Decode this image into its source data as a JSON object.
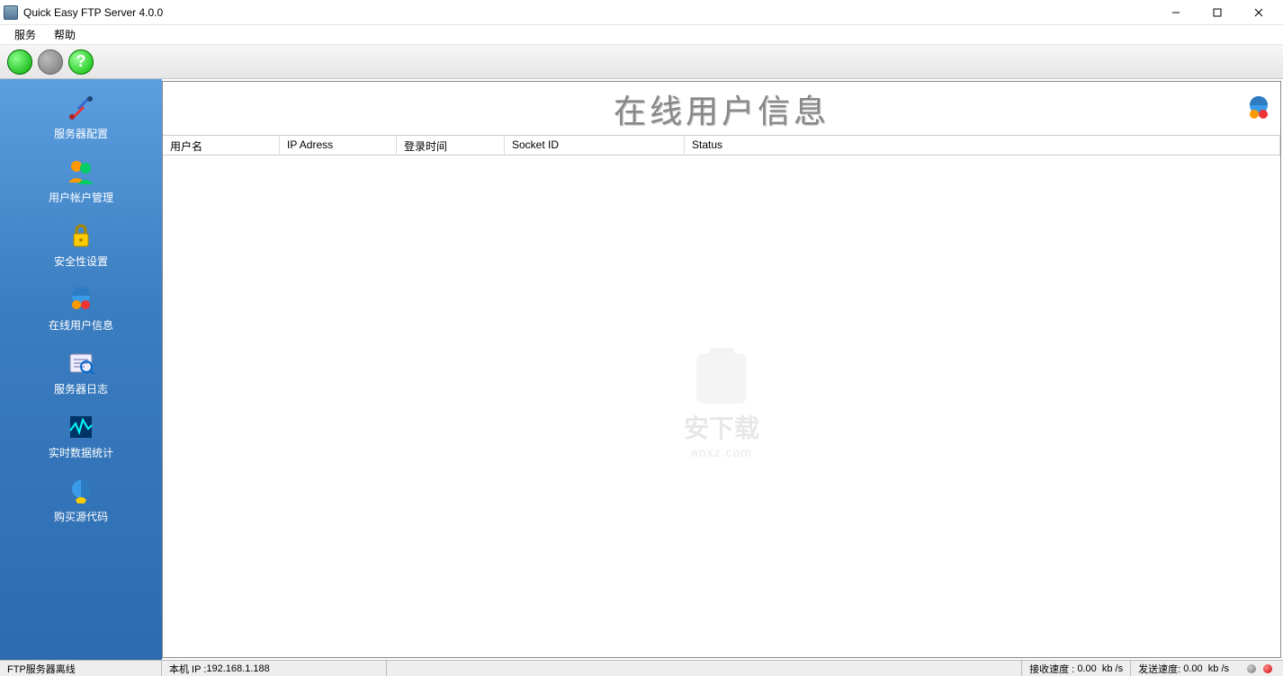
{
  "window": {
    "title": "Quick Easy FTP Server 4.0.0"
  },
  "menu": {
    "service": "服务",
    "help": "帮助"
  },
  "sidebar": {
    "items": [
      {
        "label": "服务器配置",
        "icon": "tools-icon"
      },
      {
        "label": "用户帐户管理",
        "icon": "users-icon"
      },
      {
        "label": "安全性设置",
        "icon": "lock-icon"
      },
      {
        "label": "在线用户信息",
        "icon": "online-users-icon"
      },
      {
        "label": "服务器日志",
        "icon": "log-icon"
      },
      {
        "label": "实时数据统计",
        "icon": "stats-icon"
      },
      {
        "label": "购买源代码",
        "icon": "buy-icon"
      }
    ]
  },
  "panel": {
    "title": "在线用户信息",
    "columns": {
      "username": "用户名",
      "ip": "IP Adress",
      "login_time": "登录时间",
      "socket_id": "Socket ID",
      "status": "Status"
    }
  },
  "watermark": {
    "text": "安下载",
    "sub": "anxz.com"
  },
  "statusbar": {
    "offline": "FTP服务器离线",
    "ip_label": "本机 IP :",
    "ip_value": "192.168.1.188",
    "recv_label": "接收速度 :",
    "recv_value": "0.00",
    "unit": "kb /s",
    "send_label": "发送速度:",
    "send_value": "0.00"
  }
}
